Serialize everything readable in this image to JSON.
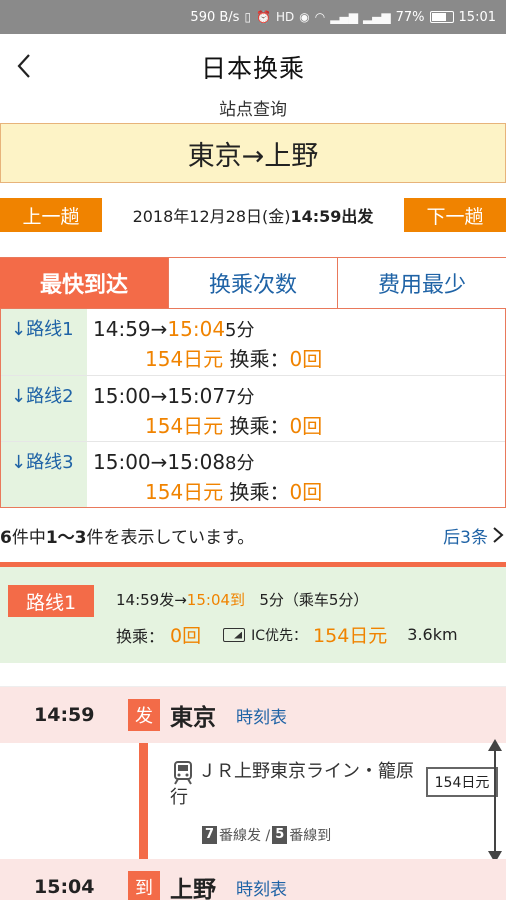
{
  "status_bar": {
    "speed": "590 B/s",
    "battery_percent": "77%",
    "battery_level": 0.77,
    "time": "15:01",
    "icons": [
      "vibrate-icon",
      "alarm-icon",
      "hd-icon",
      "eye-icon",
      "wifi-icon",
      "signal-4g-icon",
      "signal-3g-icon",
      "battery-icon"
    ]
  },
  "header": {
    "title": "日本换乘",
    "subtitle": "站点查询"
  },
  "route": {
    "text": "東京→上野"
  },
  "date_bar": {
    "prev_label": "上一趟",
    "next_label": "下一趟",
    "date": "2018年12月28日(金)",
    "depart": "14:59出发"
  },
  "tabs": [
    {
      "label": "最快到达",
      "active": true
    },
    {
      "label": "换乘次数",
      "active": false
    },
    {
      "label": "费用最少",
      "active": false
    }
  ],
  "routes": [
    {
      "label": "↓路线1",
      "dep": "14:59→",
      "arr": "15:04",
      "arr_orange": true,
      "dur": "5分",
      "price": "154日元",
      "transfer_label": "换乘：",
      "transfers": "0回"
    },
    {
      "label": "↓路线2",
      "dep": "15:00→",
      "arr": "15:07",
      "arr_orange": false,
      "dur": "7分",
      "price": "154日元",
      "transfer_label": "换乘：",
      "transfers": "0回"
    },
    {
      "label": "↓路线3",
      "dep": "15:00→",
      "arr": "15:08",
      "arr_orange": false,
      "dur": "8分",
      "price": "154日元",
      "transfer_label": "换乘：",
      "transfers": "0回"
    }
  ],
  "count_bar": {
    "total": "6",
    "t1": "件中",
    "range": "1～3",
    "t2": "件を表示しています。",
    "more_label": "后3条"
  },
  "detail": {
    "badge": "路线1",
    "dep": "14:59发→",
    "arr": "15:04到",
    "duration": "5分（乘车5分）",
    "transfer_label": "换乘：",
    "transfers": "0回",
    "ic_label": "IC优先：",
    "price": "154日元",
    "distance": "3.6km"
  },
  "itinerary": {
    "departure": {
      "time": "14:59",
      "mark": "发",
      "station": "東京",
      "timetable_label": "時刻表"
    },
    "segment": {
      "line_name": "ＪＲ上野東京ライン・籠原行",
      "dep_platform": "7",
      "dep_text": "番線发 / ",
      "arr_platform": "5",
      "arr_text": "番線到",
      "fare": "154日元"
    },
    "arrival": {
      "time": "15:04",
      "mark": "到",
      "station": "上野",
      "timetable_label": "時刻表"
    }
  },
  "colors": {
    "accent": "#f36b48",
    "orange": "#f08300",
    "link": "#1f63a6",
    "route_bg": "#fdf3c6",
    "green_bg": "#e5f3e0",
    "stop_bg": "#fbe6e4"
  }
}
